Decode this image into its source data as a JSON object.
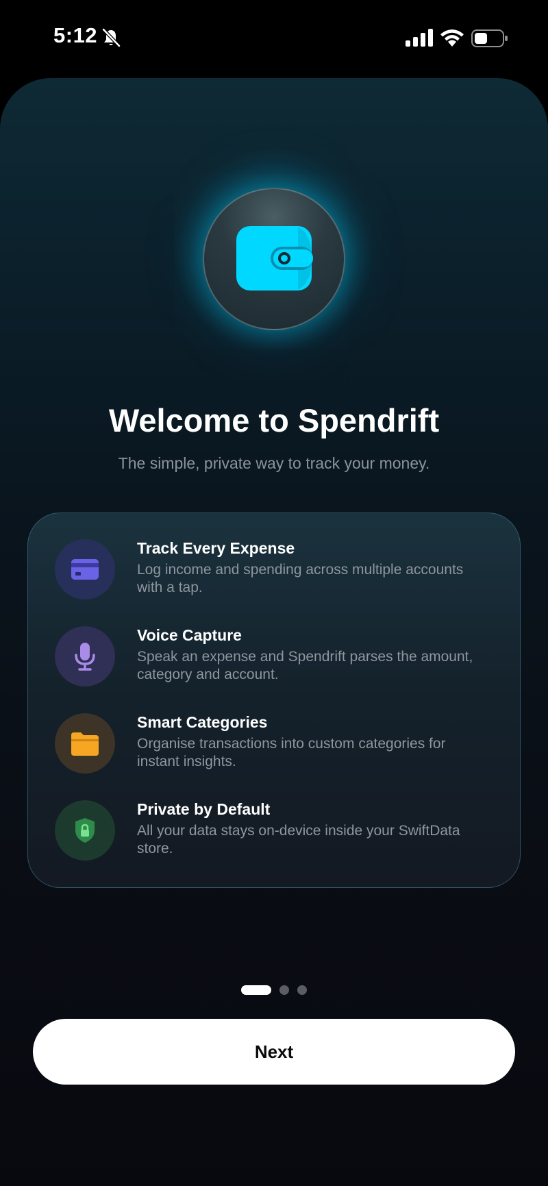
{
  "status_bar": {
    "time": "5:12",
    "icons": [
      "bell-off-icon",
      "cellular-signal-icon",
      "wifi-icon",
      "battery-icon"
    ]
  },
  "hero": {
    "icon": "wallet-icon",
    "accent_color": "#00d8ff"
  },
  "title": "Welcome to Spendrift",
  "subtitle": "The simple, private way to track your money.",
  "features": [
    {
      "title": "Track Every Expense",
      "description": "Log income and spending across multiple accounts with a tap.",
      "icon": "credit-card-icon",
      "color": "#6b63e6"
    },
    {
      "title": "Voice Capture",
      "description": "Speak an expense and Spendrift parses the amount, category and account.",
      "icon": "microphone-icon",
      "color": "#a98be8"
    },
    {
      "title": "Smart Categories",
      "description": "Organise transactions into custom categories for instant insights.",
      "icon": "folder-icon",
      "color": "#f6a623"
    },
    {
      "title": "Private by Default",
      "description": "All your data stays on-device inside your SwiftData store.",
      "icon": "lock-shield-icon",
      "color": "#2e8b4a"
    }
  ],
  "pagination": {
    "current": 1,
    "total": 3
  },
  "next_button": {
    "label": "Next"
  }
}
